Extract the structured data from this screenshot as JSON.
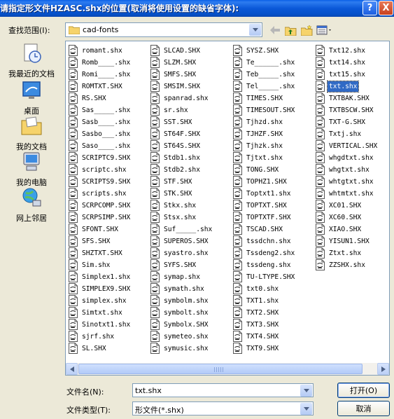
{
  "title": "请指定形文件HZASC.shx的位置(取消将使用设置的缺省字体):",
  "titlebar_buttons": {
    "help": "?",
    "close": "X"
  },
  "look_in": {
    "label": "查找范围(I):",
    "value": "cad-fonts"
  },
  "toolbar": [
    {
      "name": "back-icon"
    },
    {
      "name": "up-folder-icon"
    },
    {
      "name": "new-folder-icon"
    },
    {
      "name": "views-menu-icon"
    }
  ],
  "places": [
    {
      "label": "我最近的文档",
      "icon": "recent-documents-icon"
    },
    {
      "label": "桌面",
      "icon": "desktop-icon"
    },
    {
      "label": "我的文档",
      "icon": "my-documents-icon"
    },
    {
      "label": "我的电脑",
      "icon": "my-computer-icon"
    },
    {
      "label": "网上邻居",
      "icon": "network-places-icon"
    }
  ],
  "file_columns": [
    [
      "romant.shx",
      "Romb____.shx",
      "Romi____.shx",
      "ROMTXT.SHX",
      "RS.SHX",
      "Sas_____.shx",
      "Sasb____.shx",
      "Sasbo___.shx",
      "Saso____.shx",
      "SCRIPTC9.SHX",
      "scriptc.shx",
      "SCRIPTS9.SHX",
      "scripts.shx",
      "SCRPCOMP.SHX",
      "SCRPSIMP.SHX",
      "SFONT.SHX",
      "SFS.SHX",
      "SHZTXT.SHX",
      "Sim.shx",
      "Simplex1.shx",
      "SIMPLEX9.SHX",
      "simplex.shx",
      "Simtxt.shx",
      "Sinotxt1.shx",
      "sjrf.shx",
      "SL.SHX"
    ],
    [
      "SLCAD.SHX",
      "SLZM.SHX",
      "SMFS.SHX",
      "SMSIM.SHX",
      "spanrad.shx",
      "sr.shx",
      "SST.SHX",
      "ST64F.SHX",
      "ST64S.SHX",
      "Stdb1.shx",
      "Stdb2.shx",
      "STF.SHX",
      "STK.SHX",
      "Stkx.shx",
      "Stsx.shx",
      "Suf_____.shx",
      "SUPEROS.SHX",
      "syastro.shx",
      "SYFS.SHX",
      "symap.shx",
      "symath.shx",
      "symbolm.shx",
      "symbolt.shx",
      "Symbolx.SHX",
      "symeteo.shx",
      "symusic.shx"
    ],
    [
      "SYSZ.SHX",
      "Te______.shx",
      "Teb_____.shx",
      "Tel_____.shx",
      "TIMES.SHX",
      "TIMESOUT.SHX",
      "Tjhzd.shx",
      "TJHZF.SHX",
      "Tjhzk.shx",
      "Tjtxt.shx",
      "TONG.SHX",
      "TOPHZ1.SHX",
      "Toptxt1.shx",
      "TOPTXT.SHX",
      "TOPTXTF.SHX",
      "TSCAD.SHX",
      "tssdchn.shx",
      "Tssdeng2.shx",
      "tssdeng.shx",
      "TU-LTYPE.SHX",
      "txt0.shx",
      "TXT1.shx",
      "TXT2.SHX",
      "TXT3.SHX",
      "TXT4.SHX",
      "TXT9.SHX"
    ],
    [
      "Txt12.shx",
      "txt14.shx",
      "txt15.shx",
      "txt.shx",
      "TXTBAK.SHX",
      "TXTBSCW.SHX",
      "TXT-G.SHX",
      "Txtj.shx",
      "VERTICAL.SHX",
      "whgdtxt.shx",
      "whgtxt.shx",
      "whtgtxt.shx",
      "whtmtxt.shx",
      "XC01.SHX",
      "XC60.SHX",
      "XIAO.SHX",
      "YISUN1.SHX",
      "Ztxt.shx",
      "ZZSHX.shx"
    ]
  ],
  "selected_file": "txt.shx",
  "file_name": {
    "label": "文件名(N):",
    "value": "txt.shx"
  },
  "file_type": {
    "label": "文件类型(T):",
    "value": "形文件(*.shx)"
  },
  "buttons": {
    "open": "打开(O)",
    "cancel": "取消"
  }
}
